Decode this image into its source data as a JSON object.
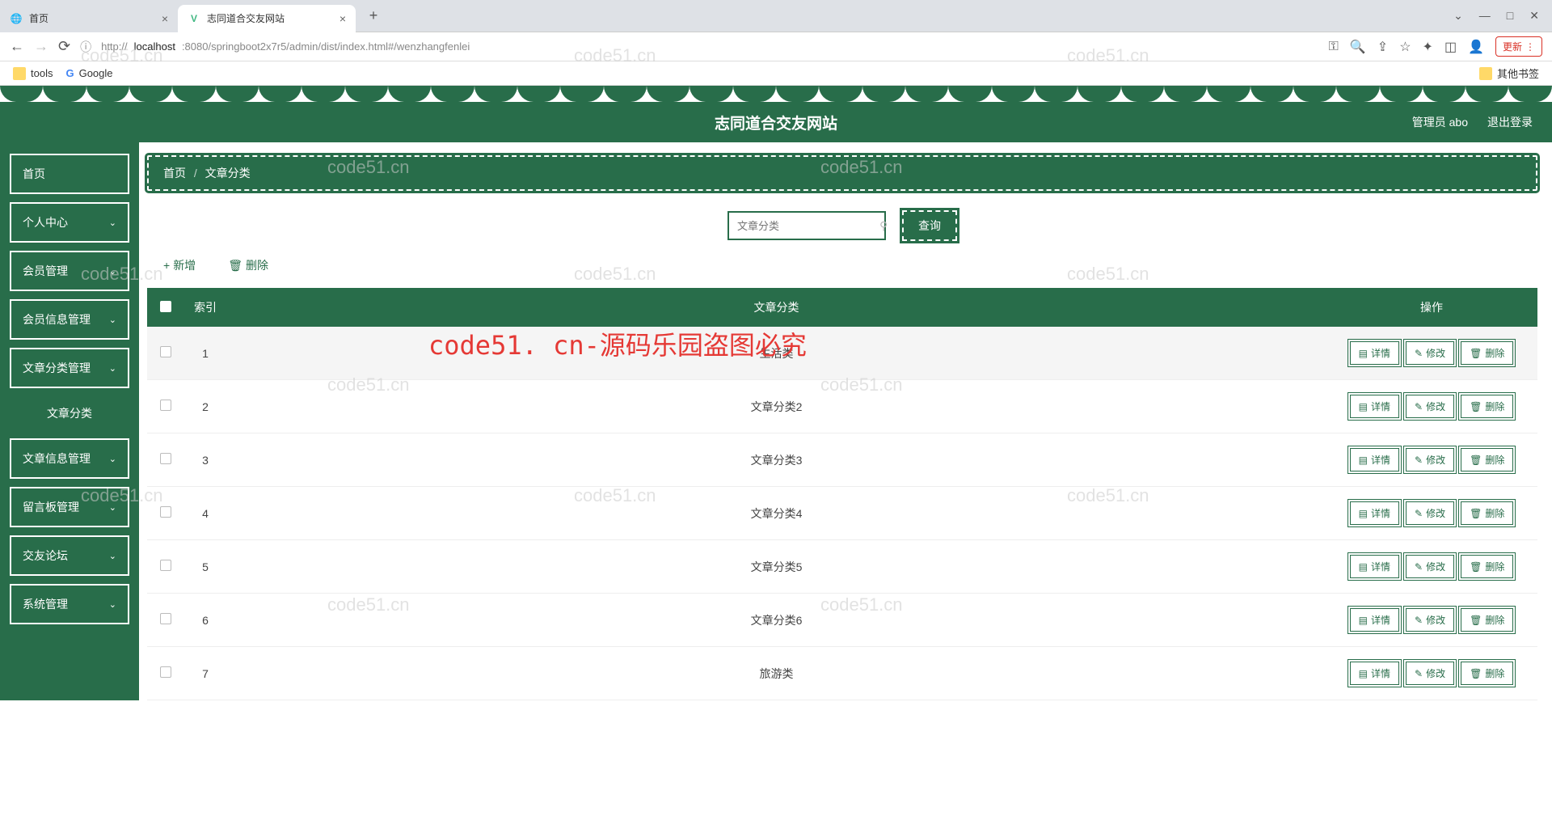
{
  "browser": {
    "tabs": [
      {
        "title": "首页",
        "active": false
      },
      {
        "title": "志同道合交友网站",
        "active": true
      }
    ],
    "url": "http://localhost:8080/springboot2x7r5/admin/dist/index.html#/wenzhangfenlei",
    "url_host": "localhost",
    "url_prefix": "http://",
    "url_rest": ":8080/springboot2x7r5/admin/dist/index.html#/wenzhangfenlei",
    "update_label": "更新",
    "bookmarks": [
      {
        "label": "tools"
      },
      {
        "label": "Google"
      }
    ],
    "other_bookmarks": "其他书签"
  },
  "header": {
    "title": "志同道合交友网站",
    "user_label": "管理员 abo",
    "logout": "退出登录"
  },
  "sidebar": {
    "items": [
      {
        "label": "首页",
        "expandable": false
      },
      {
        "label": "个人中心",
        "expandable": true
      },
      {
        "label": "会员管理",
        "expandable": true
      },
      {
        "label": "会员信息管理",
        "expandable": true
      },
      {
        "label": "文章分类管理",
        "expandable": true
      },
      {
        "label": "文章信息管理",
        "expandable": true
      },
      {
        "label": "留言板管理",
        "expandable": true
      },
      {
        "label": "交友论坛",
        "expandable": true
      },
      {
        "label": "系统管理",
        "expandable": true
      }
    ],
    "sub_item": "文章分类"
  },
  "breadcrumb": {
    "home": "首页",
    "sep": "/",
    "current": "文章分类"
  },
  "search": {
    "placeholder": "文章分类",
    "query_btn": "查询"
  },
  "actions": {
    "add": "新增",
    "delete": "删除"
  },
  "table": {
    "headers": {
      "index": "索引",
      "category": "文章分类",
      "ops": "操作"
    },
    "op_labels": {
      "detail": "详情",
      "edit": "修改",
      "delete": "删除"
    },
    "rows": [
      {
        "index": "1",
        "category": "生活类"
      },
      {
        "index": "2",
        "category": "文章分类2"
      },
      {
        "index": "3",
        "category": "文章分类3"
      },
      {
        "index": "4",
        "category": "文章分类4"
      },
      {
        "index": "5",
        "category": "文章分类5"
      },
      {
        "index": "6",
        "category": "文章分类6"
      },
      {
        "index": "7",
        "category": "旅游类"
      }
    ]
  },
  "watermarks": {
    "gray": "code51.cn",
    "red": "code51. cn-源码乐园盗图必究"
  }
}
